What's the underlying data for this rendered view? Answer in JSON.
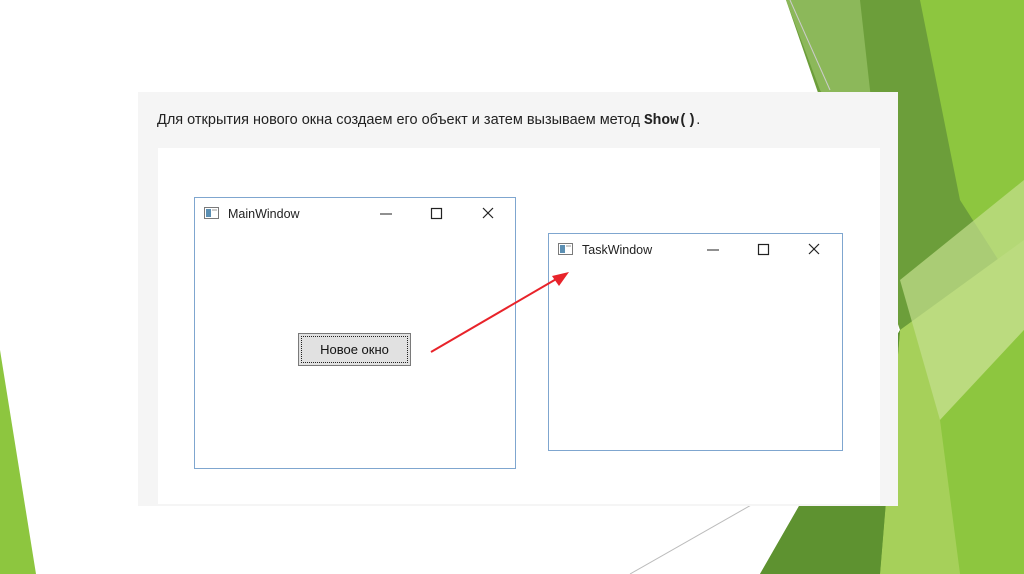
{
  "slide": {
    "caption_text": "Для открытия нового окна создаем его объект и затем вызываем метод ",
    "caption_code": "Show()",
    "caption_end": ".",
    "accent_colors": [
      "#8dc63f",
      "#6aa234",
      "#a6d05a",
      "#4e8a2a"
    ]
  },
  "main_window": {
    "title": "MainWindow",
    "button_label": "Новое окно",
    "icons": [
      "app-icon",
      "minimize-icon",
      "maximize-icon",
      "close-icon"
    ]
  },
  "task_window": {
    "title": "TaskWindow",
    "icons": [
      "app-icon",
      "minimize-icon",
      "maximize-icon",
      "close-icon"
    ]
  },
  "annotation": {
    "type": "arrow",
    "color": "#e8232a"
  }
}
